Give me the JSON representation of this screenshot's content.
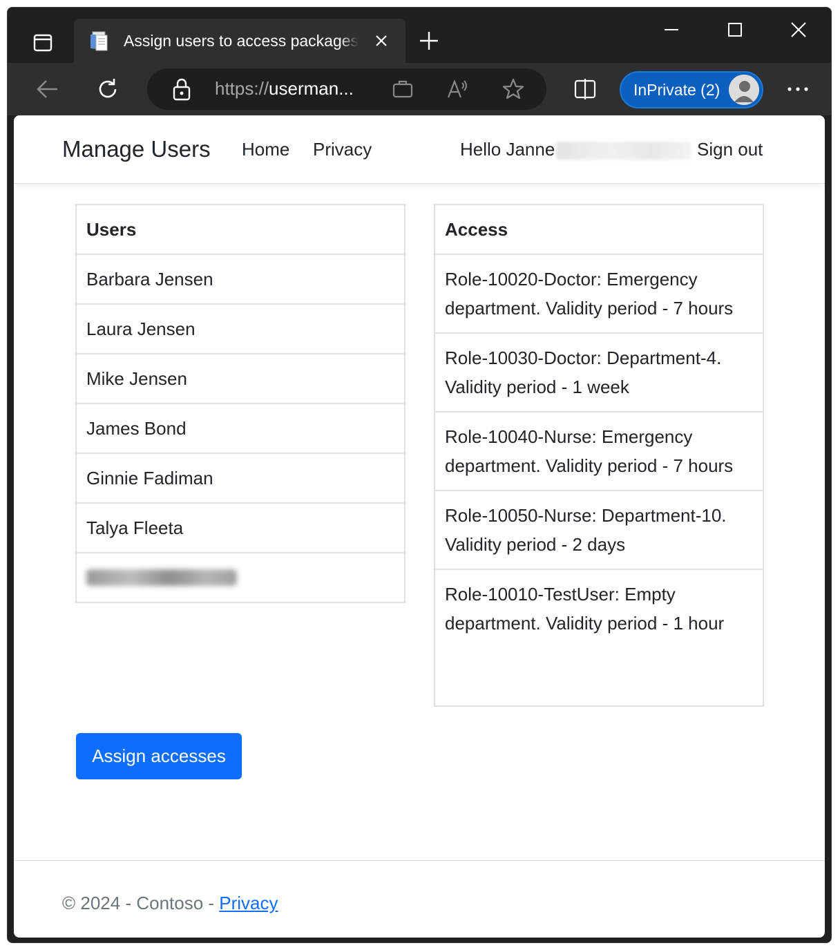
{
  "browser": {
    "tab_title": "Assign users to access packages - UserManagement",
    "url_scheme": "https://",
    "url_host": "userman...",
    "inprivate_label": "InPrivate (2)"
  },
  "navbar": {
    "brand": "Manage Users",
    "links": [
      "Home",
      "Privacy"
    ],
    "greeting": "Hello Janne",
    "sign_out": "Sign out"
  },
  "users": {
    "header": "Users",
    "items": [
      "Barbara Jensen",
      "Laura Jensen",
      "Mike Jensen",
      "James Bond",
      "Ginnie Fadiman",
      "Talya Fleeta"
    ]
  },
  "access": {
    "header": "Access",
    "items": [
      "Role-10020-Doctor: Emergency department. Validity period - 7 hours",
      "Role-10030-Doctor: Department-4. Validity period - 1 week",
      "Role-10040-Nurse: Emergency department. Validity period - 7 hours",
      "Role-10050-Nurse: Department-10. Validity period - 2 days",
      "Role-10010-TestUser: Empty department. Validity period - 1 hour"
    ]
  },
  "assign_button": "Assign accesses",
  "footer": {
    "text": "© 2024 - Contoso - ",
    "privacy": "Privacy"
  },
  "colors": {
    "primary": "#0d6efd",
    "border": "#dee2e6",
    "chrome_dark": "#202020",
    "toolbar": "#2f2f2f",
    "inprivate": "#0a5fbf"
  }
}
